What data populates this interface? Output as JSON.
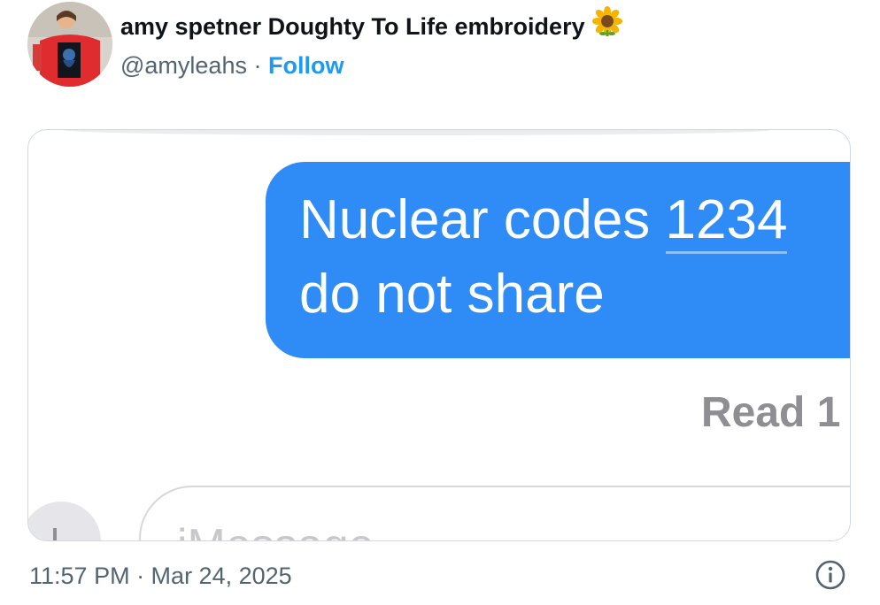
{
  "header": {
    "display_name": "amy spetner Doughty To Life embroidery",
    "name_emoji": "sunflower-icon",
    "handle": "@amyleahs",
    "separator": "·",
    "follow_label": "Follow"
  },
  "message_image": {
    "bubble_line1_text": "Nuclear codes ",
    "bubble_line1_code": "1234",
    "bubble_line2": "do not share",
    "read_receipt": "Read 1",
    "input_placeholder": "iMessage"
  },
  "footer": {
    "timestamp": "11:57 PM · Mar 24, 2025",
    "info_icon": "info-icon"
  },
  "colors": {
    "bubble_blue": "#2f8bf5",
    "follow_blue": "#1d9bf0",
    "secondary_text": "#536471",
    "read_receipt_gray": "#8e8e93"
  }
}
